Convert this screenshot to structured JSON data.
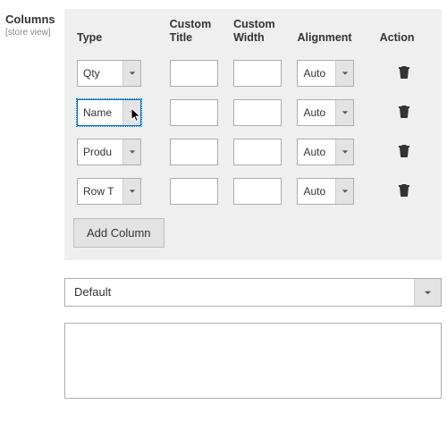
{
  "sidebar": {
    "title": "Columns",
    "scope": "[store view]"
  },
  "headers": {
    "type": "Type",
    "custom_title": "Custom Title",
    "custom_width": "Custom Width",
    "alignment": "Alignment",
    "action": "Action"
  },
  "rows": [
    {
      "type": "Qty",
      "custom_title": "",
      "custom_width": "",
      "alignment": "Auto",
      "active": false
    },
    {
      "type": "Name",
      "custom_title": "",
      "custom_width": "",
      "alignment": "Auto",
      "active": true
    },
    {
      "type": "Produ",
      "custom_title": "",
      "custom_width": "",
      "alignment": "Auto",
      "active": false
    },
    {
      "type": "Row T",
      "custom_title": "",
      "custom_width": "",
      "alignment": "Auto",
      "active": false
    }
  ],
  "buttons": {
    "add_column": "Add Column"
  },
  "template_select": {
    "value": "Default"
  },
  "textarea": {
    "value": ""
  }
}
